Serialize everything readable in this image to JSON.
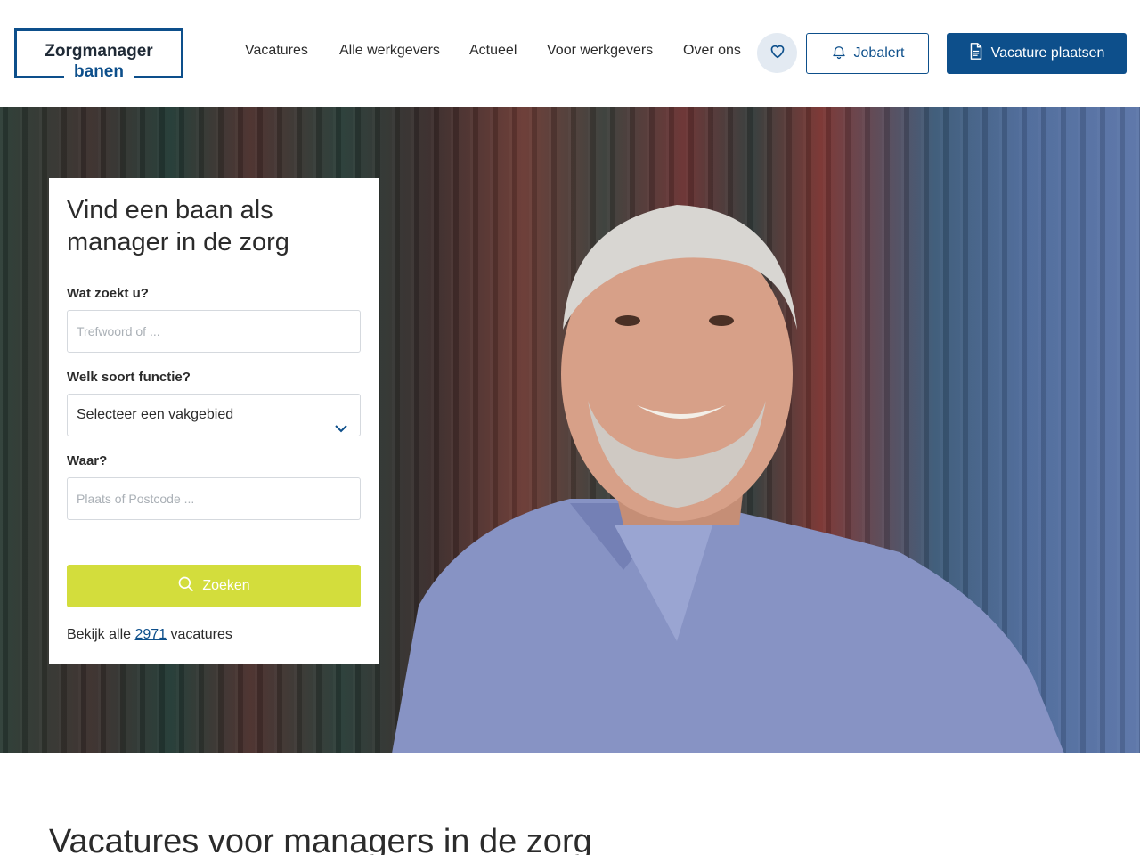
{
  "header": {
    "logo_title": "Zorgmanager",
    "logo_sub": "banen",
    "nav": [
      "Vacatures",
      "Alle werkgevers",
      "Actueel",
      "Voor werkgevers",
      "Over ons"
    ],
    "favorites_icon": "heart-icon",
    "jobalert_label": "Jobalert",
    "jobalert_icon": "bell-icon",
    "post_vacancy_label": "Vacature plaatsen",
    "post_vacancy_icon": "document-icon",
    "brand_color": "#0d4f8b"
  },
  "search": {
    "title": "Vind een baan als manager in de zorg",
    "keyword_label": "Wat zoekt u?",
    "keyword_placeholder": "Trefwoord of ...",
    "function_label": "Welk soort functie?",
    "function_selected": "Selecteer een vakgebied",
    "location_label": "Waar?",
    "location_placeholder": "Plaats of Postcode ...",
    "button_label": "Zoeken",
    "button_color": "#d3dd3c",
    "all_prefix": "Bekijk alle",
    "all_count": "2971",
    "all_suffix": "vacatures"
  },
  "section": {
    "title": "Vacatures voor managers in de zorg"
  }
}
